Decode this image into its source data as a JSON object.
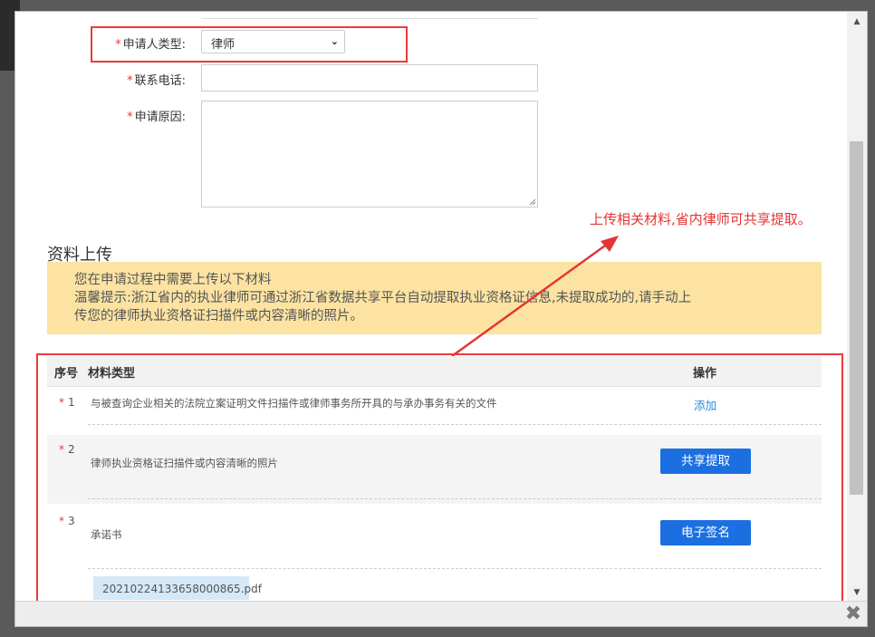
{
  "form": {
    "applicant_type": {
      "label": "申请人类型:",
      "value": "律师"
    },
    "phone": {
      "label": "联系电话:",
      "value": ""
    },
    "reason": {
      "label": "申请原因:",
      "value": ""
    },
    "required_mark": "*"
  },
  "upload": {
    "title": "资料上传",
    "notice_line1": "您在申请过程中需要上传以下材料",
    "notice_line2": "温馨提示:浙江省内的执业律师可通过浙江省数据共享平台自动提取执业资格证信息,未提取成功的,请手动上",
    "notice_line3": "传您的律师执业资格证扫描件或内容清晰的照片。",
    "annotation": "上传相关材料,省内律师可共享提取。",
    "columns": {
      "num": "序号",
      "type": "材料类型",
      "op": "操作"
    },
    "rows": [
      {
        "num": "1",
        "text": "与被查询企业相关的法院立案证明文件扫描件或律师事务所开具的与承办事务有关的文件",
        "action": "添加"
      },
      {
        "num": "2",
        "text": "律师执业资格证扫描件或内容清晰的照片",
        "action": "共享提取"
      },
      {
        "num": "3",
        "text": "承诺书",
        "action": "电子签名"
      }
    ],
    "file_name": "20210224133658000865.pdf"
  },
  "colors": {
    "accent_red": "#e93b3b",
    "button_blue": "#1c6fe0",
    "notice_bg": "#fce3a2",
    "link_blue": "#2b8ed1"
  },
  "icons": {
    "close": "close-icon",
    "select": "chevron-down-icon",
    "scroll_up": "triangle-up-icon",
    "scroll_down": "triangle-down-icon"
  }
}
